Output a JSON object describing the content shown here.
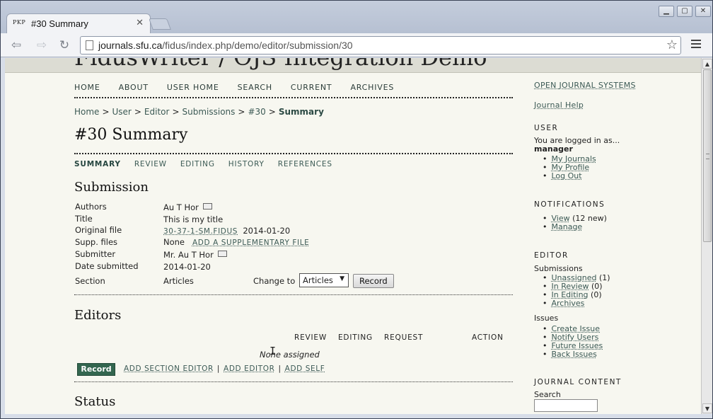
{
  "browser": {
    "tab_favicon": "PKP",
    "tab_title": "#30 Summary",
    "tab_close": "✕",
    "url_host": "journals.sfu.ca",
    "url_path": "/fidus/index.php/demo/editor/submission/30"
  },
  "site": {
    "title": "FidusWriter / OJS Integration Demo",
    "nav": [
      "HOME",
      "ABOUT",
      "USER HOME",
      "SEARCH",
      "CURRENT",
      "ARCHIVES"
    ]
  },
  "breadcrumb": {
    "items": [
      "Home",
      "User",
      "Editor",
      "Submissions",
      "#30"
    ],
    "current": "Summary",
    "separator": ">"
  },
  "page_title": "#30 Summary",
  "subtabs": [
    "SUMMARY",
    "REVIEW",
    "EDITING",
    "HISTORY",
    "REFERENCES"
  ],
  "submission": {
    "heading": "Submission",
    "labels": {
      "authors": "Authors",
      "title": "Title",
      "original_file": "Original file",
      "supp_files": "Supp. files",
      "submitter": "Submitter",
      "date_submitted": "Date submitted",
      "section": "Section"
    },
    "values": {
      "authors": "Au T Hor",
      "title": "This is my title",
      "original_file_link": "30-37-1-SM.FIDUS",
      "original_file_date": "2014-01-20",
      "supp_files": "None",
      "supp_files_link": "ADD A SUPPLEMENTARY FILE",
      "submitter": "Mr. Au T Hor",
      "date_submitted": "2014-01-20",
      "section": "Articles"
    },
    "change_to_label": "Change to",
    "section_select": "Articles",
    "record_button": "Record"
  },
  "editors": {
    "heading": "Editors",
    "columns": [
      "REVIEW",
      "EDITING",
      "REQUEST",
      "ACTION"
    ],
    "none_assigned": "None assigned",
    "record_button": "Record",
    "actions": [
      "ADD SECTION EDITOR",
      "ADD EDITOR",
      "ADD SELF"
    ]
  },
  "status": {
    "heading": "Status"
  },
  "sidebar": {
    "ojs_link": "OPEN JOURNAL SYSTEMS",
    "journal_help": "Journal Help",
    "user": {
      "heading": "USER",
      "logged_in_as": "You are logged in as...",
      "username": "manager",
      "links": [
        "My Journals",
        "My Profile",
        "Log Out"
      ]
    },
    "notifications": {
      "heading": "NOTIFICATIONS",
      "view": "View",
      "view_count": "(12 new)",
      "manage": "Manage"
    },
    "editor": {
      "heading": "EDITOR",
      "submissions_label": "Submissions",
      "submissions": [
        {
          "label": "Unassigned",
          "count": "(1)"
        },
        {
          "label": "In Review",
          "count": "(0)"
        },
        {
          "label": "In Editing",
          "count": "(0)"
        },
        {
          "label": "Archives",
          "count": ""
        }
      ],
      "issues_label": "Issues",
      "issues": [
        "Create Issue",
        "Notify Users",
        "Future Issues",
        "Back Issues"
      ]
    },
    "journal_content": {
      "heading": "JOURNAL CONTENT",
      "search_label": "Search"
    }
  }
}
